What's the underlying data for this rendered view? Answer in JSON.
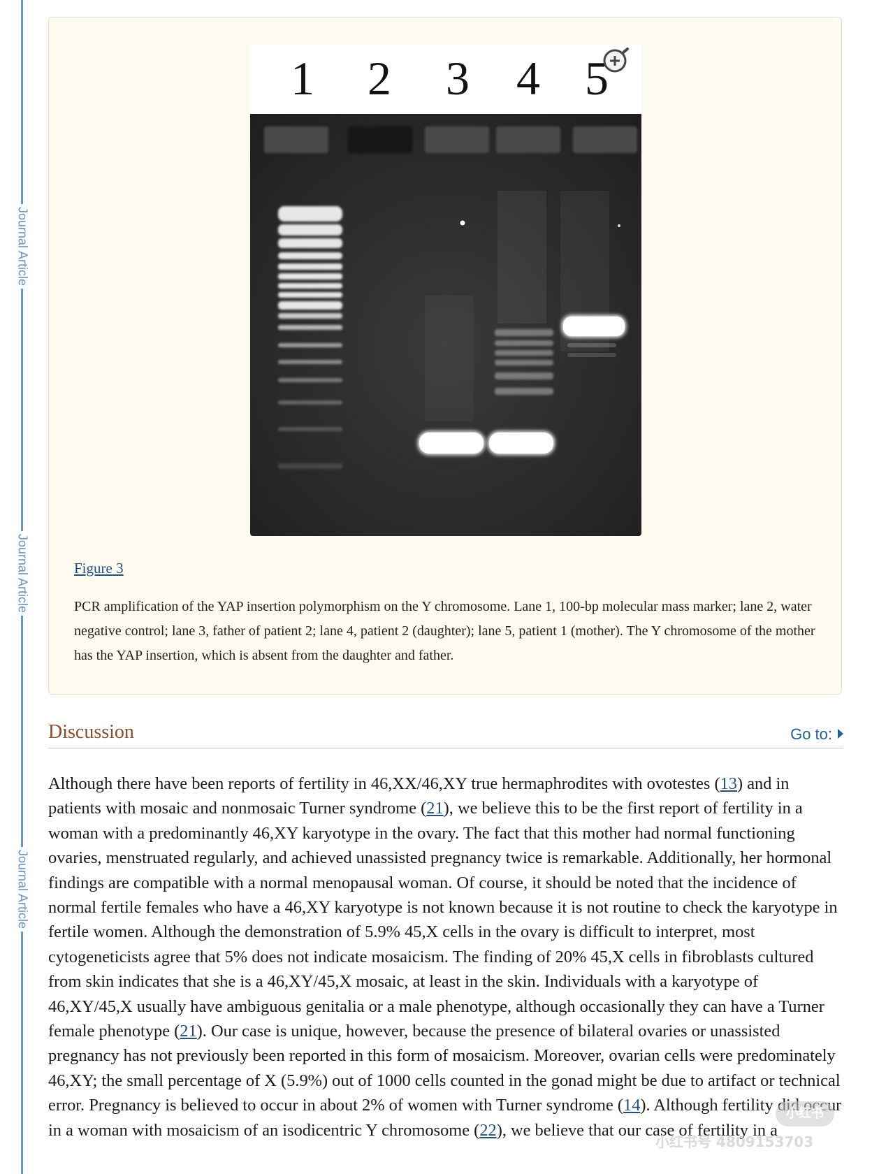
{
  "sidebar": {
    "labels": [
      "Journal Article",
      "Journal Article",
      "Journal Article"
    ]
  },
  "figure": {
    "lane_numbers": [
      "1",
      "2",
      "3",
      "4",
      "5"
    ],
    "label": "Figure 3",
    "caption": "PCR amplification of the YAP insertion polymorphism on the Y chromosome. Lane 1, 100-bp molecular mass marker; lane 2, water negative control; lane 3, father of patient 2; lane 4, patient 2 (daughter); lane 5, patient 1 (mother). The Y chromosome of the mother has the YAP insertion, which is absent from the daughter and father.",
    "zoom_icon": "zoom-in-icon"
  },
  "section": {
    "title": "Discussion",
    "goto_label": "Go to:"
  },
  "body": {
    "s1": "Although there have been reports of fertility in 46,XX/46,XY true hermaphrodites with ovotestes (",
    "ref1": "13",
    "s2": ") and in patients with mosaic and nonmosaic Turner syndrome (",
    "ref2": "21",
    "s3": "), we believe this to be the first report of fertility in a woman with a predominantly 46,XY karyotype in the ovary. The fact that this mother had normal functioning ovaries, menstruated regularly, and achieved unassisted pregnancy twice is remarkable. Additionally, her hormonal findings are compatible with a normal menopausal woman. Of course, it should be noted that the incidence of normal fertile females who have a 46,XY karyotype is not known because it is not routine to check the karyotype in fertile women. Although the demonstration of 5.9% 45,X cells in the ovary is difficult to interpret, most cytogeneticists agree that 5% does not indicate mosaicism. The finding of 20% 45,X cells in fibroblasts cultured from skin indicates that she is a 46,XY/45,X mosaic, at least in the skin. Individuals with a karyotype of 46,XY/45,X usually have ambiguous genitalia or a male phenotype, although occasionally they can have a Turner female phenotype (",
    "ref3": "21",
    "s4": "). Our case is unique, however, because the presence of bilateral ovaries or unassisted pregnancy has not previously been reported in this form of mosaicism. Moreover, ovarian cells were predominately 46,XY; the small percentage of X (5.9%) out of 1000 cells counted in the gonad might be due to artifact or technical error. Pregnancy is believed to occur in about 2% of women with Turner syndrome (",
    "ref4": "14",
    "s5": "). Although fertility did occur in a woman with mosaicism of an isodicentric Y chromosome (",
    "ref5": "22",
    "s6": "), we believe that our case of fertility in a"
  },
  "watermark": {
    "badge": "小红书",
    "text": "小红书号 4809153703"
  }
}
